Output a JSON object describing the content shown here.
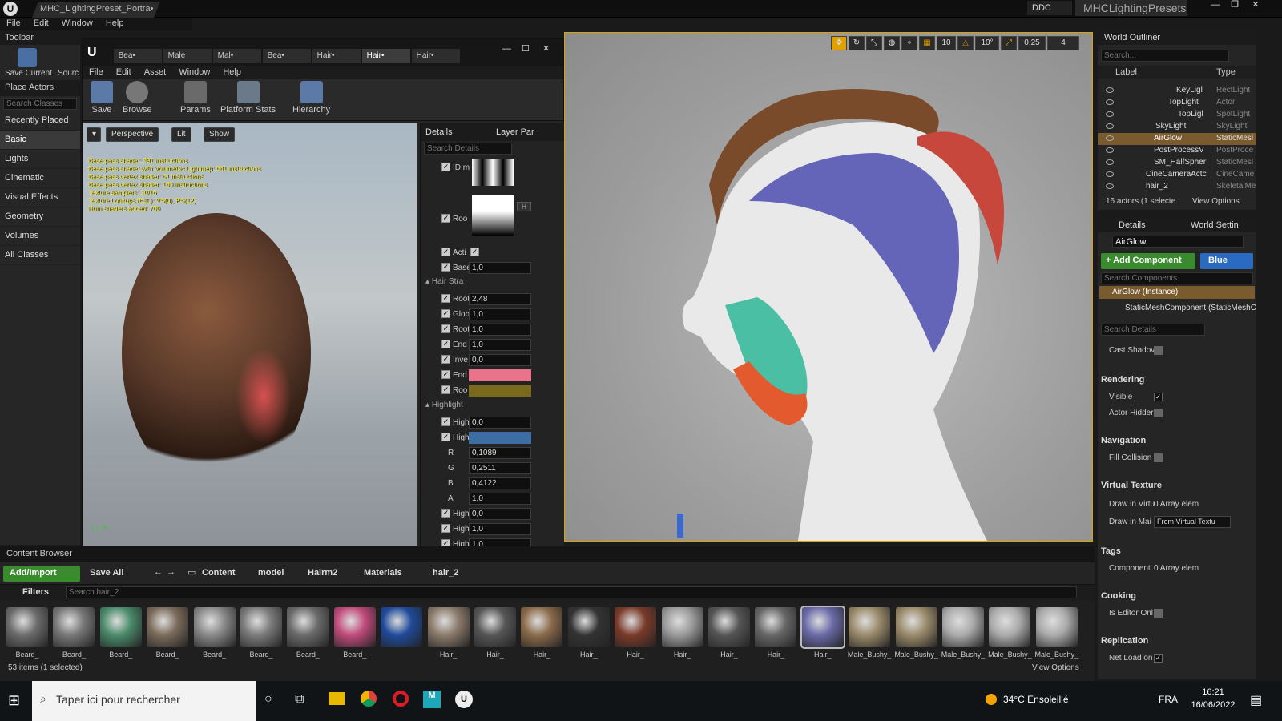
{
  "titlebar": {
    "tab_title": "MHC_LightingPreset_Portra•",
    "ddc": "DDC",
    "preset_name": "MHCLightingPresets",
    "menu": [
      "File",
      "Edit",
      "Window",
      "Help"
    ]
  },
  "toolbar": {
    "label": "Toolbar",
    "save_current": "Save Current",
    "source": "Sourc"
  },
  "left_panel": {
    "header": "Place Actors",
    "search_placeholder": "Search Classes",
    "items": [
      "Recently Placed",
      "Basic",
      "Lights",
      "Cinematic",
      "Visual Effects",
      "Geometry",
      "Volumes",
      "All Classes"
    ]
  },
  "material_editor": {
    "tabs": [
      "Bea•",
      "Male",
      "Mal•",
      "Bea•",
      "Hair•",
      "Hair•",
      "Hair•"
    ],
    "menu": [
      "File",
      "Edit",
      "Asset",
      "Window",
      "Help"
    ],
    "tools": [
      "Save",
      "Browse",
      "Params",
      "Platform Stats",
      "Hierarchy"
    ],
    "viewport_buttons": [
      "Perspective",
      "Lit",
      "Show"
    ],
    "stats": [
      "Base pass shader: 391 instructions",
      "Base pass shader with Volumetric Lightmap: 581 instructions",
      "Base pass vertex shader: 51 instructions",
      "Base pass vertex shader: 160 instructions",
      "Texture samplers: 10/16",
      "Texture Lookups (Est.): VS(0), PS(12)",
      "Num shaders added: 700"
    ]
  },
  "details_panel": {
    "tabs": [
      "Details",
      "Layer Par"
    ],
    "search_placeholder": "Search Details",
    "rows": [
      {
        "label": "ID m",
        "value": ""
      },
      {
        "label": "Roo",
        "value": ""
      },
      {
        "label": "Acti",
        "value": ""
      },
      {
        "label": "Base",
        "value": "1,0"
      },
      {
        "label": "Root",
        "value": "2,48"
      },
      {
        "label": "Glob",
        "value": "1,0"
      },
      {
        "label": "Root",
        "value": "1,0"
      },
      {
        "label": "End",
        "value": "1,0"
      },
      {
        "label": "Inve",
        "value": "0,0"
      },
      {
        "label": "End",
        "value": ""
      },
      {
        "label": "Roo",
        "value": ""
      },
      {
        "label": "High",
        "value": "0,0"
      },
      {
        "label": "High",
        "value": ""
      },
      {
        "label": "R",
        "value": "0,1089"
      },
      {
        "label": "G",
        "value": "0,2511"
      },
      {
        "label": "B",
        "value": "0,4122"
      },
      {
        "label": "A",
        "value": "1,0"
      },
      {
        "label": "High",
        "value": "0,0"
      },
      {
        "label": "High",
        "value": "1,0"
      },
      {
        "label": "High",
        "value": "1,0"
      }
    ],
    "sections": [
      "Hair Stra",
      "Highlight"
    ],
    "tex_badge": "H",
    "colors": {
      "end": "#e8738a",
      "root": "#7a6a1e",
      "highlight": "#3d6ea3"
    }
  },
  "viewport_toolbar": [
    "10",
    "10°",
    "0,25",
    "4"
  ],
  "outliner": {
    "title": "World Outliner",
    "search_placeholder": "Search...",
    "col_label": "Label",
    "col_type": "Type",
    "rows": [
      {
        "label": "KeyLigl",
        "type": "RectLight"
      },
      {
        "label": "TopLight",
        "type": "Actor"
      },
      {
        "label": "TopLigl",
        "type": "SpotLight"
      },
      {
        "label": "SkyLight",
        "type": "SkyLight"
      },
      {
        "label": "AirGlow",
        "type": "StaticMesl"
      },
      {
        "label": "PostProcessV",
        "type": "PostProce"
      },
      {
        "label": "SM_HalfSpher",
        "type": "StaticMesl"
      },
      {
        "label": "CineCameraActc",
        "type": "CineCame"
      },
      {
        "label": "hair_2",
        "type": "SkeletalMe"
      }
    ],
    "status": "16 actors (1 selecte",
    "view_options": "View Options"
  },
  "right_details": {
    "tabs": [
      "Details",
      "World Settin"
    ],
    "name": "AirGlow",
    "add_component": "+ Add Component",
    "blueprint": "Blue",
    "search_components": "Search Components",
    "instance": "AirGlow (Instance)",
    "component": "StaticMeshComponent (StaticMeshC",
    "search_details": "Search Details",
    "cast_shadow": "Cast Shadov",
    "sections": [
      {
        "title": "Rendering",
        "props": [
          "Visible",
          "Actor Hidder"
        ]
      },
      {
        "title": "Navigation",
        "props": [
          "Fill Collision"
        ]
      },
      {
        "title": "Virtual Texture",
        "props": [
          "Draw in Virtu",
          "Draw in Mai"
        ]
      },
      {
        "title": "Tags",
        "props": [
          "Component"
        ]
      },
      {
        "title": "Cooking",
        "props": [
          "Is Editor Onl"
        ]
      },
      {
        "title": "Replication",
        "props": [
          "Net Load on"
        ]
      }
    ],
    "array_elem": "0 Array elem",
    "from_vt": "From Virtual Textu"
  },
  "content_browser": {
    "title": "Content Browser",
    "add_import": "Add/Import",
    "save_all": "Save All",
    "path": [
      "Content",
      "model",
      "Hairm2",
      "Materials",
      "hair_2"
    ],
    "filters": "Filters",
    "search_placeholder": "Search hair_2",
    "status": "53 items (1 selected)",
    "view_options": "View Options",
    "thumbs": [
      "Beard_",
      "Beard_",
      "Beard_",
      "Beard_",
      "Beard_",
      "Beard_",
      "Beard_",
      "Beard_",
      "",
      "Hair_",
      "Hair_",
      "Hair_",
      "Hair_",
      "Hair_",
      "Hair_",
      "Hair_",
      "Hair_",
      "Hair_",
      "Male_Bushy_",
      "Male_Bushy_",
      "Male_Bushy_",
      "Male_Bushy_",
      "Male_Bushy_"
    ]
  },
  "taskbar": {
    "search": "Taper ici pour rechercher",
    "weather": "34°C  Ensoleillé",
    "lang": "FRA",
    "time": "16:21",
    "date": "16/06/2022"
  }
}
